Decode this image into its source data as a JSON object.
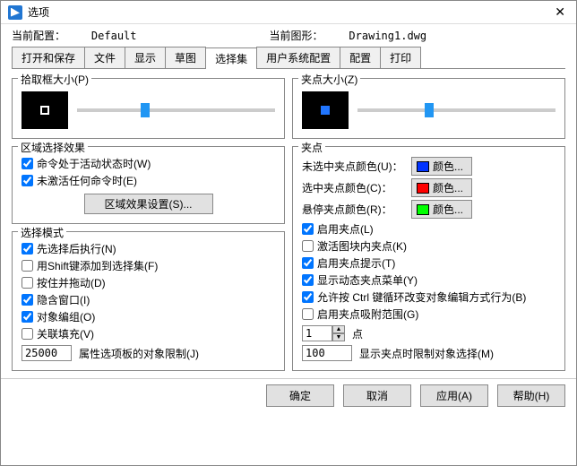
{
  "window": {
    "title": "选项"
  },
  "info": {
    "currentConfigLabel": "当前配置：",
    "currentConfigValue": "Default",
    "currentDrawingLabel": "当前图形：",
    "currentDrawingValue": "Drawing1.dwg"
  },
  "tabs": {
    "items": [
      "打开和保存",
      "文件",
      "显示",
      "草图",
      "选择集",
      "用户系统配置",
      "配置",
      "打印"
    ],
    "active": "选择集"
  },
  "left": {
    "pickbox": {
      "title": "拾取框大小(P)",
      "slider": 32
    },
    "region": {
      "title": "区域选择效果",
      "activeCmd": {
        "label": "命令处于活动状态时(W)",
        "checked": true
      },
      "noCmd": {
        "label": "未激活任何命令时(E)",
        "checked": true
      },
      "settingsBtn": "区域效果设置(S)..."
    },
    "mode": {
      "title": "选择模式",
      "items": [
        {
          "label": "先选择后执行(N)",
          "checked": true
        },
        {
          "label": "用Shift键添加到选择集(F)",
          "checked": false
        },
        {
          "label": "按住并拖动(D)",
          "checked": false
        },
        {
          "label": "隐含窗口(I)",
          "checked": true
        },
        {
          "label": "对象编组(O)",
          "checked": true
        },
        {
          "label": "关联填充(V)",
          "checked": false
        }
      ],
      "limit": {
        "value": "25000",
        "label": "属性选项板的对象限制(J)"
      }
    }
  },
  "right": {
    "gripSize": {
      "title": "夹点大小(Z)",
      "slider": 34
    },
    "grips": {
      "title": "夹点",
      "colors": {
        "unselected": {
          "label": "未选中夹点颜色(U)：",
          "btn": "颜色...",
          "hex": "#0033ff"
        },
        "selected": {
          "label": "选中夹点颜色(C)：",
          "btn": "颜色...",
          "hex": "#ff0000"
        },
        "hover": {
          "label": "悬停夹点颜色(R)：",
          "btn": "颜色...",
          "hex": "#00ff00"
        }
      },
      "checks": [
        {
          "label": "启用夹点(L)",
          "checked": true
        },
        {
          "label": "激活图块内夹点(K)",
          "checked": false
        },
        {
          "label": "启用夹点提示(T)",
          "checked": true
        },
        {
          "label": "显示动态夹点菜单(Y)",
          "checked": true
        },
        {
          "label": "允许按 Ctrl 键循环改变对象编辑方式行为(B)",
          "checked": true
        },
        {
          "label": "启用夹点吸附范围(G)",
          "checked": false
        }
      ],
      "pointInput": {
        "value": "1",
        "unit": "点"
      },
      "limit": {
        "value": "100",
        "label": "显示夹点时限制对象选择(M)"
      }
    }
  },
  "footer": {
    "ok": "确定",
    "cancel": "取消",
    "apply": "应用(A)",
    "help": "帮助(H)"
  }
}
